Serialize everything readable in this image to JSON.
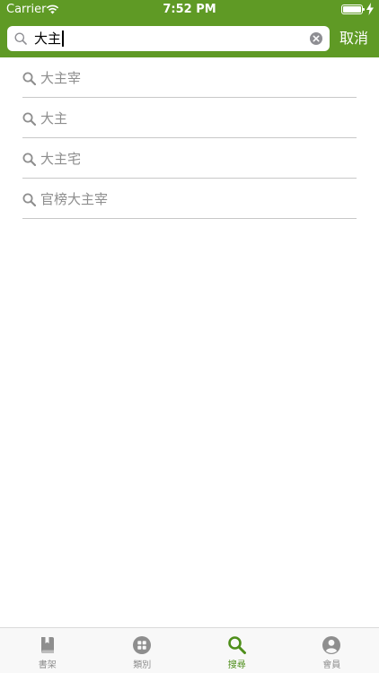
{
  "status_bar": {
    "carrier": "Carrier",
    "time": "7:52 PM"
  },
  "search": {
    "query": "大主",
    "cancel_label": "取消"
  },
  "suggestions": [
    {
      "label": "大主宰",
      "icon": "search-icon"
    },
    {
      "label": "大主",
      "icon": "search-icon"
    },
    {
      "label": "大主宅",
      "icon": "search-icon"
    },
    {
      "label": "官榜大主宰",
      "icon": "search-icon"
    }
  ],
  "tab_bar": {
    "tabs": [
      {
        "label": "書架",
        "icon": "book-icon"
      },
      {
        "label": "類別",
        "icon": "grid-icon"
      },
      {
        "label": "搜尋",
        "icon": "search-icon",
        "active": true
      },
      {
        "label": "會員",
        "icon": "user-icon"
      }
    ]
  },
  "colors": {
    "header": "#5f9a25",
    "tab_active": "#4e8e1a",
    "tab_inactive": "#8e8e8e",
    "suggestion_text": "#8e8e8e"
  }
}
